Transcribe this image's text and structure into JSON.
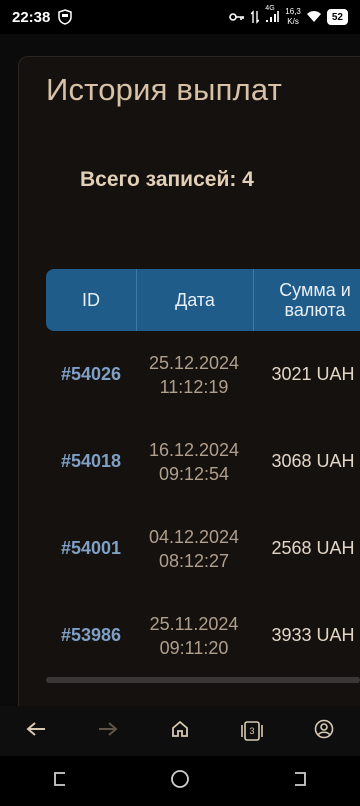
{
  "status_bar": {
    "time": "22:38",
    "network_type": "4G",
    "net_speed_value": "16,3",
    "net_speed_unit": "K/s",
    "battery": "52"
  },
  "page": {
    "title": "История выплат",
    "total_label": "Всего записей: 4"
  },
  "table": {
    "headers": {
      "id": "ID",
      "date": "Дата",
      "sum": "Сумма и валюта"
    },
    "rows": [
      {
        "id": "#54026",
        "date": "25.12.2024",
        "time": "11:12:19",
        "sum": "3021 UAH"
      },
      {
        "id": "#54018",
        "date": "16.12.2024",
        "time": "09:12:54",
        "sum": "3068 UAH"
      },
      {
        "id": "#54001",
        "date": "04.12.2024",
        "time": "08:12:27",
        "sum": "2568 UAH"
      },
      {
        "id": "#53986",
        "date": "25.11.2024",
        "time": "09:11:20",
        "sum": "3933 UAH"
      }
    ]
  },
  "browser_bar": {
    "tabs_count": "3",
    "icons": [
      "back-arrow-icon",
      "forward-arrow-icon",
      "home-icon",
      "tabs-icon",
      "profile-icon"
    ]
  },
  "colors": {
    "header_bg": "#1f5c8a",
    "accent_text": "#d7c2a8",
    "id_text": "#7f9fc5"
  }
}
